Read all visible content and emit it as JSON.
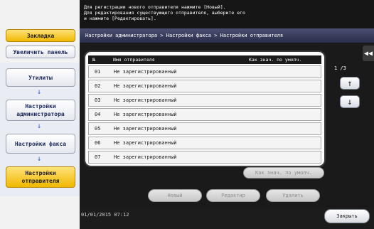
{
  "app": {
    "accent": "#f0b800",
    "header_bg": "#161616"
  },
  "left": {
    "bookmark": "Закладка",
    "increase_panel": "Увеличить панель",
    "steps": [
      {
        "label": "Утилиты"
      },
      {
        "label": "Настройки администратора"
      },
      {
        "label": "Настройки факса"
      },
      {
        "label": "Настройки отправителя"
      }
    ]
  },
  "header": {
    "lines": [
      "Для регистрации нового отправителя нажмите [Новый].",
      "Для редактирования существующего отправителя, выберите его",
      "и нажмите [Редактировать]."
    ],
    "breadcrumb": "Настройки администратора > Настройки факса > Настройки отправителя"
  },
  "table": {
    "columns": {
      "no": "№",
      "name": "Имя отправителя",
      "default": "Как знач. по умолч."
    },
    "rows": [
      {
        "no": "01",
        "name": "Не зарегистрированный"
      },
      {
        "no": "02",
        "name": "Не зарегистрированный"
      },
      {
        "no": "03",
        "name": "Не зарегистрированный"
      },
      {
        "no": "04",
        "name": "Не зарегистрированный"
      },
      {
        "no": "05",
        "name": "Не зарегистрированный"
      },
      {
        "no": "06",
        "name": "Не зарегистрированный"
      },
      {
        "no": "07",
        "name": "Не зарегистрированный"
      }
    ]
  },
  "pager": {
    "text": "1 /3",
    "up_icon": "arrow-up-icon",
    "down_icon": "arrow-down-icon"
  },
  "buttons": {
    "set_default": "Как знач. по умолч.",
    "new": "Новый",
    "edit": "Редактир",
    "delete": "Удалить",
    "close": "Закрыть"
  },
  "footer": {
    "datetime": "01/01/2015  07:12"
  }
}
